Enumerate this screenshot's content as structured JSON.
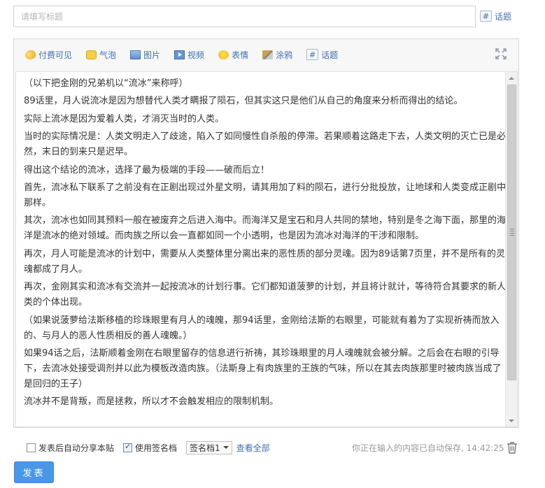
{
  "title_field": {
    "placeholder": "请填写标题",
    "value": ""
  },
  "topic_top": {
    "label": "话题"
  },
  "toolbar": {
    "items": [
      {
        "label": "付费可见",
        "icon": "coin-icon"
      },
      {
        "label": "气泡",
        "icon": "bubble-icon"
      },
      {
        "label": "图片",
        "icon": "image-icon"
      },
      {
        "label": "视频",
        "icon": "video-icon"
      },
      {
        "label": "表情",
        "icon": "emoji-icon"
      },
      {
        "label": "涂鸦",
        "icon": "brush-icon"
      },
      {
        "label": "话题",
        "icon": "hash-icon"
      }
    ]
  },
  "content": {
    "paragraphs": [
      "（以下把金刚的兄弟机以“流冰”来称呼）",
      "89话里，月人说流冰是因为想替代人类才瞒报了陨石，但其实这只是他们从自己的角度来分析而得出的结论。",
      "实际上流冰是因为爱着人类，才消灭当时的人类。",
      "当时的实际情况是：人类文明走入了歧途，陷入了如同慢性自杀般的停滞。若果顺着这路走下去，人类文明的灭亡已是必然，末日的到来只是迟早。",
      "得出这个结论的流冰，选择了最为极端的手段——破而后立！",
      "首先，流冰私下联系了之前没有在正剧出现过外星文明，请其用加了料的陨石，进行分批投放，让地球和人类变成正剧中那样。",
      "其次，流冰也如同其预料一般在被废弃之后进入海中。而海洋又是宝石和月人共同的禁地，特别是冬之海下面，那里的海洋是流冰的绝对领域。而肉族之所以会一直都如同一个小透明，也是因为流冰对海洋的干涉和限制。",
      "再次，月人可能是流冰的计划中，需要从人类整体里分离出来的恶性质的部分灵魂。因为89话第7页里，并不是所有的灵魂都成了月人。",
      "再次，金刚其实和流冰有交流并一起按流冰的计划行事。它们都知道菠萝的计划，并且将计就计，等待符合其要求的新人类的个体出现。",
      "（如果说菠萝给法斯移植的珍珠眼里有月人的魂魄，那94话里，金刚给法斯的右眼里，可能就有着为了实现祈祷而放入的、与月人的恶人性质相反的善人魂魄。）",
      "如果94话之后，法斯顺着金刚在右眼里留存的信息进行祈祷，其珍珠眼里的月人魂魄就会被分解。之后会在右眼的引导下，去流冰处接受调剂并以此为模板改造肉族。（法斯身上有肉族里的王族的气味，所以在其去肉族那里时被肉族当成了是回归的王子）",
      "流冰并不是背叛，而是拯救，所以才不会触发相应的限制机制。"
    ]
  },
  "bottom": {
    "auto_share_label": "发表后自动分享本贴",
    "auto_share_checked": false,
    "use_signature_label": "使用签名档",
    "use_signature_checked": true,
    "signature_selected": "签名档1",
    "view_all_label": "查看全部",
    "autosave_text": "你正在输入的内容已自动保存, 14:42:25"
  },
  "publish": {
    "label": "发表"
  },
  "colors": {
    "link": "#3f6fb6",
    "button": "#4a97e8"
  }
}
